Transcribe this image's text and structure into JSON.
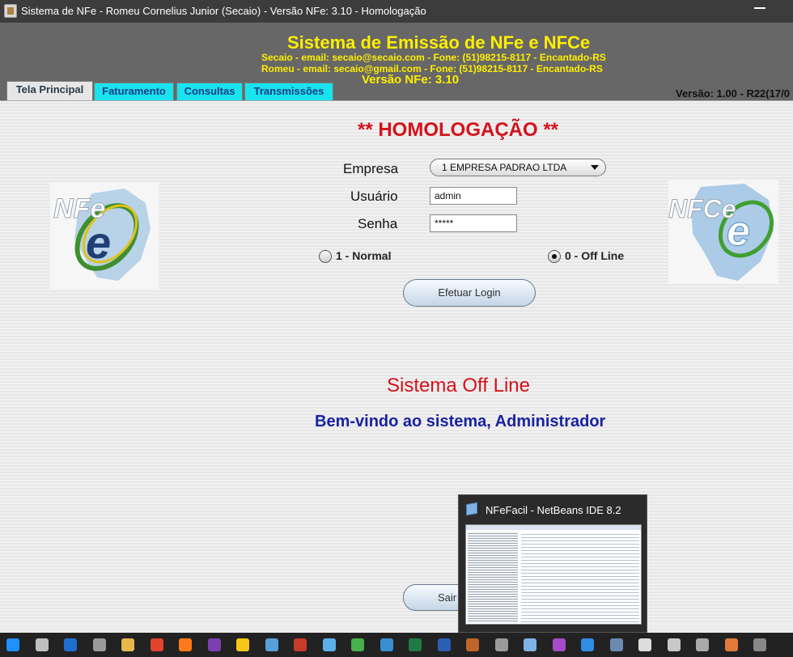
{
  "window": {
    "title": "Sistema de NFe - Romeu Cornelius Junior (Secaio) - Versão NFe: 3.10 - Homologação"
  },
  "header": {
    "title": "Sistema de Emissão de NFe e NFCe",
    "contact_lines": [
      "Secaio  - email: secaio@secaio.com  - Fone: (51)98215-8117 - Encantado-RS",
      "Romeu  - email: secaio@gmail.com  - Fone: (51)98215-8117 - Encantado-RS"
    ],
    "nfe_version": "Versão NFe: 3.10",
    "app_version": "Versão: 1.00 - R22(17/0"
  },
  "tabs": [
    {
      "label": "Tela Principal",
      "active": true
    },
    {
      "label": "Faturamento",
      "active": false
    },
    {
      "label": "Consultas",
      "active": false
    },
    {
      "label": "Transmissões",
      "active": false
    }
  ],
  "logos": {
    "left_text": "NFe",
    "right_text": "NFCe"
  },
  "login": {
    "environment_banner": "** HOMOLOGAÇÃO **",
    "empresa_label": "Empresa",
    "empresa_value": "1 EMPRESA PADRAO LTDA",
    "usuario_label": "Usuário",
    "usuario_value": "admin",
    "senha_label": "Senha",
    "senha_value": "*****",
    "radio_normal": "1 - Normal",
    "radio_offline": "0 - Off Line",
    "selected_mode": "0 - Off Line",
    "login_button": "Efetuar Login"
  },
  "status": {
    "offline_message": "Sistema Off Line",
    "welcome_message": "Bem-vindo ao sistema, Administrador"
  },
  "footer": {
    "exit_button": "Sair"
  },
  "taskbar_preview": {
    "title": "NFeFacil - NetBeans IDE 8.2"
  },
  "colors": {
    "header_yellow": "#ffee00",
    "alert_red": "#d4121a",
    "welcome_blue": "#1a22a0",
    "tab_cyan": "#19e3ec"
  },
  "taskbar_icons": [
    "windows-icon",
    "task-view-icon",
    "edge-icon",
    "calculator-icon",
    "file-explorer-icon",
    "chrome-icon",
    "firefox-icon",
    "slack-icon",
    "weather-icon",
    "app-icon",
    "paint-icon",
    "notepad-icon",
    "project-icon",
    "launcher-icon",
    "excel-icon",
    "word-icon",
    "spartan-icon",
    "sign-icon",
    "netbeans-icon",
    "postgres-icon",
    "vscode-icon",
    "database-icon",
    "terminal-icon",
    "network-icon",
    "settings-icon",
    "java-icon",
    "arrow-icon"
  ]
}
